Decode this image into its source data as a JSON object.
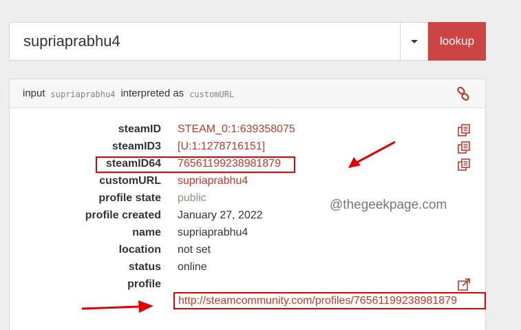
{
  "search": {
    "value": "supriaprabhu4",
    "lookup_label": "lookup"
  },
  "panel": {
    "heading": {
      "input_word": "input",
      "input_value": "supriaprabhu4",
      "interpreted_word": "interpreted as",
      "interpreted_value": "customURL"
    },
    "rows": [
      {
        "label": "steamID",
        "value": "STEAM_0:1:639358075"
      },
      {
        "label": "steamID3",
        "value": "[U:1:1278716151]"
      },
      {
        "label": "steamID64",
        "value": "76561199238981879"
      },
      {
        "label": "customURL",
        "value": "supriaprabhu4"
      },
      {
        "label": "profile state",
        "value": "public"
      },
      {
        "label": "profile created",
        "value": "January 27, 2022"
      },
      {
        "label": "name",
        "value": "supriaprabhu4"
      },
      {
        "label": "location",
        "value": "not set"
      },
      {
        "label": "status",
        "value": "online"
      },
      {
        "label": "profile",
        "value": "http://steamcommunity.com/profiles/76561199238981879"
      }
    ]
  },
  "watermark": "@thegeekpage.com",
  "colors": {
    "accent": "#cc4444",
    "value_red": "#c0392b",
    "annotation_red": "#e00000"
  },
  "icons": {
    "link": "link-icon",
    "copy": "copy-icon",
    "external": "external-link-icon"
  }
}
